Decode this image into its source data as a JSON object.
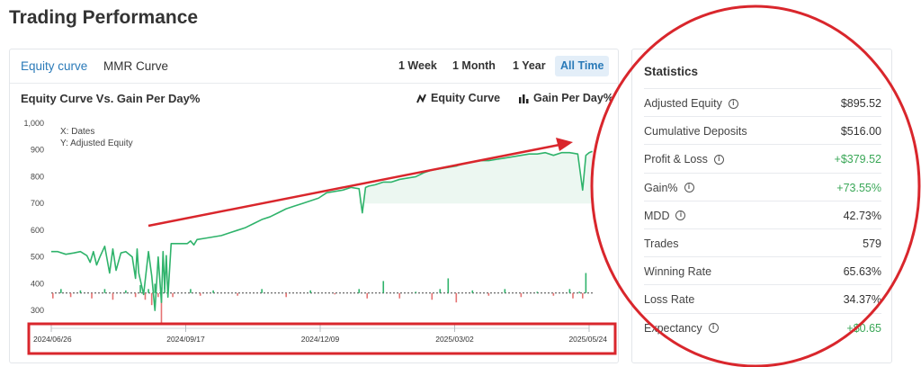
{
  "page": {
    "title": "Trading Performance"
  },
  "tabs": [
    {
      "label": "Equity curve",
      "active": true
    },
    {
      "label": "MMR Curve",
      "active": false
    }
  ],
  "ranges": [
    {
      "label": "1 Week",
      "active": false
    },
    {
      "label": "1 Month",
      "active": false
    },
    {
      "label": "1 Year",
      "active": false
    },
    {
      "label": "All Time",
      "active": true
    }
  ],
  "chart": {
    "title": "Equity Curve Vs. Gain Per Day%",
    "legend_equity": "Equity Curve",
    "legend_gain": "Gain Per Day%"
  },
  "chart_data": {
    "type": "line",
    "title": "Equity Curve Vs. Gain Per Day%",
    "xlabel": "X: Dates",
    "ylabel": "Y: Adjusted Equity",
    "ylim": [
      250,
      1000
    ],
    "yticks": [
      "1,000",
      "900",
      "800",
      "700",
      "600",
      "500",
      "400",
      "300"
    ],
    "ytick_values": [
      1000,
      900,
      800,
      700,
      600,
      500,
      400,
      300
    ],
    "xticks": [
      "2024/06/26",
      "2024/09/17",
      "2024/12/09",
      "2025/03/02",
      "2025/05/24"
    ],
    "xtick_values": [
      0,
      83,
      166,
      249,
      332
    ],
    "grid": false,
    "legend": "top-right",
    "series": [
      {
        "name": "Equity Curve",
        "color": "#2fb36b",
        "x": [
          0,
          4,
          9,
          14,
          18,
          22,
          24,
          26,
          28,
          30,
          33,
          36,
          38,
          40,
          43,
          46,
          50,
          52,
          53,
          54,
          57,
          60,
          62,
          64,
          66,
          68,
          69,
          70,
          71,
          72,
          74,
          76,
          80,
          84,
          86,
          88,
          90,
          95,
          100,
          105,
          110,
          115,
          120,
          125,
          130,
          135,
          140,
          145,
          150,
          155,
          160,
          165,
          170,
          175,
          180,
          185,
          190,
          192,
          194,
          196,
          200,
          205,
          210,
          215,
          220,
          225,
          230,
          235,
          240,
          245,
          250,
          255,
          260,
          265,
          270,
          275,
          280,
          285,
          290,
          295,
          300,
          305,
          310,
          315,
          320,
          325,
          328,
          330,
          332,
          334
        ],
        "values": [
          520,
          520,
          510,
          515,
          520,
          505,
          480,
          520,
          470,
          500,
          540,
          440,
          530,
          450,
          515,
          520,
          500,
          420,
          530,
          440,
          360,
          520,
          430,
          300,
          500,
          330,
          520,
          380,
          505,
          350,
          550,
          550,
          550,
          550,
          560,
          545,
          565,
          570,
          575,
          580,
          590,
          600,
          610,
          625,
          640,
          650,
          665,
          680,
          690,
          700,
          710,
          720,
          740,
          745,
          750,
          760,
          755,
          665,
          760,
          765,
          770,
          780,
          780,
          790,
          795,
          800,
          815,
          825,
          830,
          835,
          840,
          850,
          855,
          860,
          860,
          865,
          870,
          875,
          880,
          885,
          885,
          890,
          880,
          890,
          890,
          885,
          750,
          880,
          890,
          895
        ]
      }
    ],
    "bars": {
      "name": "Gain Per Day%",
      "baseline": 365,
      "x": [
        1,
        6,
        12,
        18,
        25,
        33,
        38,
        46,
        52,
        55,
        58,
        60,
        62,
        64,
        66,
        68,
        70,
        75,
        86,
        92,
        100,
        115,
        130,
        145,
        160,
        175,
        190,
        195,
        205,
        215,
        225,
        235,
        240,
        245,
        250,
        260,
        270,
        280,
        290,
        300,
        310,
        320,
        322,
        326,
        328,
        330
      ],
      "values": [
        345,
        380,
        350,
        375,
        345,
        380,
        340,
        375,
        350,
        395,
        340,
        380,
        320,
        400,
        350,
        250,
        390,
        350,
        380,
        355,
        375,
        355,
        380,
        350,
        375,
        360,
        380,
        345,
        410,
        345,
        370,
        340,
        380,
        420,
        330,
        375,
        355,
        380,
        350,
        370,
        355,
        380,
        345,
        370,
        345,
        440
      ],
      "up_color": "#2fb36b",
      "down_color": "#e57373"
    }
  },
  "statistics": {
    "title": "Statistics",
    "rows": [
      {
        "label": "Adjusted Equity",
        "value": "$895.52",
        "info": true,
        "positive": false
      },
      {
        "label": "Cumulative Deposits",
        "value": "$516.00",
        "info": false,
        "positive": false
      },
      {
        "label": "Profit & Loss",
        "value": "+$379.52",
        "info": true,
        "positive": true
      },
      {
        "label": "Gain%",
        "value": "+73.55%",
        "info": true,
        "positive": true
      },
      {
        "label": "MDD",
        "value": "42.73%",
        "info": true,
        "positive": false
      },
      {
        "label": "Trades",
        "value": "579",
        "info": false,
        "positive": false
      },
      {
        "label": "Winning Rate",
        "value": "65.63%",
        "info": false,
        "positive": false
      },
      {
        "label": "Loss Rate",
        "value": "34.37%",
        "info": false,
        "positive": false
      },
      {
        "label": "Expectancy",
        "value": "+$0.65",
        "info": true,
        "positive": true
      }
    ]
  },
  "annotation_color": "#d9262c",
  "icons": {
    "info": "info-icon",
    "line": "line-chart-icon",
    "bar": "bar-chart-icon"
  }
}
